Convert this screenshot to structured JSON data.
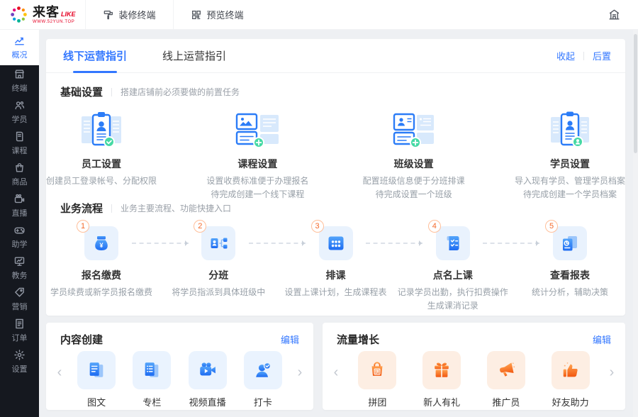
{
  "header": {
    "brand": {
      "name": "来客",
      "suffix": "LIKE",
      "site": "WWW.52YUN.TOP"
    },
    "actions": [
      {
        "label": "装修终端",
        "icon": "paint-roller-icon"
      },
      {
        "label": "预览终端",
        "icon": "qr-code-icon"
      }
    ],
    "home_icon": "shop-building-icon"
  },
  "sidebar": {
    "items": [
      {
        "label": "概况",
        "icon": "overview-chart-icon",
        "active": true
      },
      {
        "label": "终端",
        "icon": "storefront-icon",
        "active": false
      },
      {
        "label": "学员",
        "icon": "students-icon",
        "active": false
      },
      {
        "label": "课程",
        "icon": "course-book-icon",
        "active": false
      },
      {
        "label": "商品",
        "icon": "goods-bag-icon",
        "active": false
      },
      {
        "label": "直播",
        "icon": "live-camera-icon",
        "active": false
      },
      {
        "label": "助学",
        "icon": "study-aid-gamepad-icon",
        "active": false
      },
      {
        "label": "教务",
        "icon": "academic-monitor-icon",
        "active": false
      },
      {
        "label": "营销",
        "icon": "marketing-tag-icon",
        "active": false
      },
      {
        "label": "订单",
        "icon": "order-doc-icon",
        "active": false
      },
      {
        "label": "设置",
        "icon": "settings-gear-icon",
        "active": false
      }
    ]
  },
  "guide": {
    "tabs": [
      {
        "label": "线下运营指引",
        "active": true
      },
      {
        "label": "线上运营指引",
        "active": false
      }
    ],
    "actions": {
      "collapse": "收起",
      "send_back": "后置"
    },
    "basic": {
      "title": "基础设置",
      "subtitle": "搭建店铺前必须要做的前置任务",
      "cards": [
        {
          "title": "员工设置",
          "icon": "staff-setup-icon",
          "desc1": "创建员工登录帐号、分配权限",
          "desc2": ""
        },
        {
          "title": "课程设置",
          "icon": "course-setup-icon",
          "desc1": "设置收费标准便于办理报名",
          "desc2": "待完成创建一个线下课程"
        },
        {
          "title": "班级设置",
          "icon": "class-setup-icon",
          "desc1": "配置班级信息便于分班排课",
          "desc2": "待完成设置一个班级"
        },
        {
          "title": "学员设置",
          "icon": "student-setup-icon",
          "desc1": "导入现有学员、管理学员档案",
          "desc2": "待完成创建一个学员档案"
        }
      ]
    },
    "flow": {
      "title": "业务流程",
      "subtitle": "业务主要流程、功能快捷入口",
      "steps": [
        {
          "num": "1",
          "title": "报名缴费",
          "icon": "enroll-pay-icon",
          "glyph": "¥",
          "desc1": "学员续费或新学员报名缴费",
          "desc2": ""
        },
        {
          "num": "2",
          "title": "分班",
          "icon": "assign-class-icon",
          "desc1": "将学员指派到具体班级中",
          "desc2": ""
        },
        {
          "num": "3",
          "title": "排课",
          "icon": "schedule-icon",
          "desc1": "设置上课计划，生成课程表",
          "desc2": ""
        },
        {
          "num": "4",
          "title": "点名上课",
          "icon": "rollcall-icon",
          "desc1": "记录学员出勤，执行扣费操作",
          "desc2": "生成课消记录"
        },
        {
          "num": "5",
          "title": "查看报表",
          "icon": "report-icon",
          "desc1": "统计分析，辅助决策",
          "desc2": ""
        }
      ]
    }
  },
  "panels": {
    "content": {
      "title": "内容创建",
      "edit": "编辑",
      "items": [
        {
          "label": "图文",
          "icon": "article-icon"
        },
        {
          "label": "专栏",
          "icon": "column-icon"
        },
        {
          "label": "视频直播",
          "icon": "video-live-icon"
        },
        {
          "label": "打卡",
          "icon": "checkin-icon"
        }
      ]
    },
    "growth": {
      "title": "流量增长",
      "edit": "编辑",
      "items": [
        {
          "label": "拼团",
          "icon": "group-buy-icon",
          "glyph": "拼"
        },
        {
          "label": "新人有礼",
          "icon": "newcomer-gift-icon"
        },
        {
          "label": "推广员",
          "icon": "promoter-icon"
        },
        {
          "label": "好友助力",
          "icon": "friend-boost-icon"
        }
      ]
    }
  },
  "colors": {
    "accent": "#3377ff",
    "orange": "#f4692a",
    "sidebar_bg": "#15181f",
    "icon_bg_blue": "#e9f2fd",
    "icon_bg_orange": "#fdeee3",
    "green_badge": "#45d9a4",
    "brand_red": "#e60023"
  }
}
